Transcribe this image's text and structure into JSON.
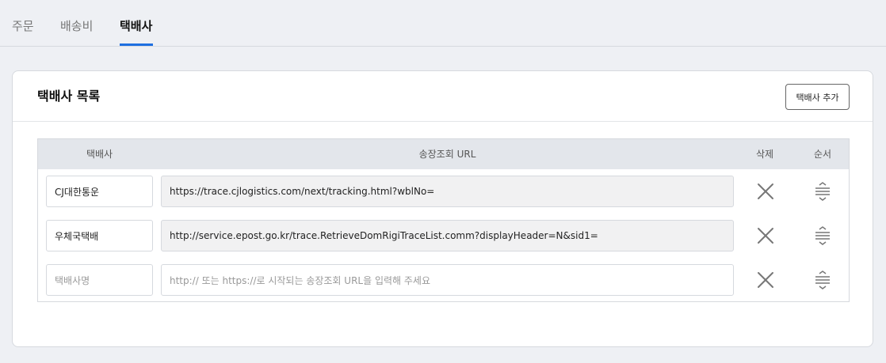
{
  "tabs": [
    {
      "label": "주문"
    },
    {
      "label": "배송비"
    },
    {
      "label": "택배사",
      "active": true
    }
  ],
  "card": {
    "title": "택배사 목록",
    "add_button_label": "택배사 추가"
  },
  "table": {
    "headers": {
      "courier": "택배사",
      "url": "송장조회 URL",
      "delete": "삭제",
      "order": "순서"
    },
    "rows": [
      {
        "name": "CJ대한통운",
        "url": "https://trace.cjlogistics.com/next/tracking.html?wblNo="
      },
      {
        "name": "우체국택배",
        "url": "http://service.epost.go.kr/trace.RetrieveDomRigiTraceList.comm?displayHeader=N&sid1="
      }
    ],
    "new_row": {
      "name_placeholder": "택배사명",
      "url_placeholder": "http:// 또는 https://로 시작되는 송장조회 URL을 입력해 주세요"
    }
  },
  "colors": {
    "accent": "#1e6fe0",
    "icon": "#777777"
  },
  "icons": {
    "delete": "close-icon",
    "order": "drag-handle-icon"
  }
}
